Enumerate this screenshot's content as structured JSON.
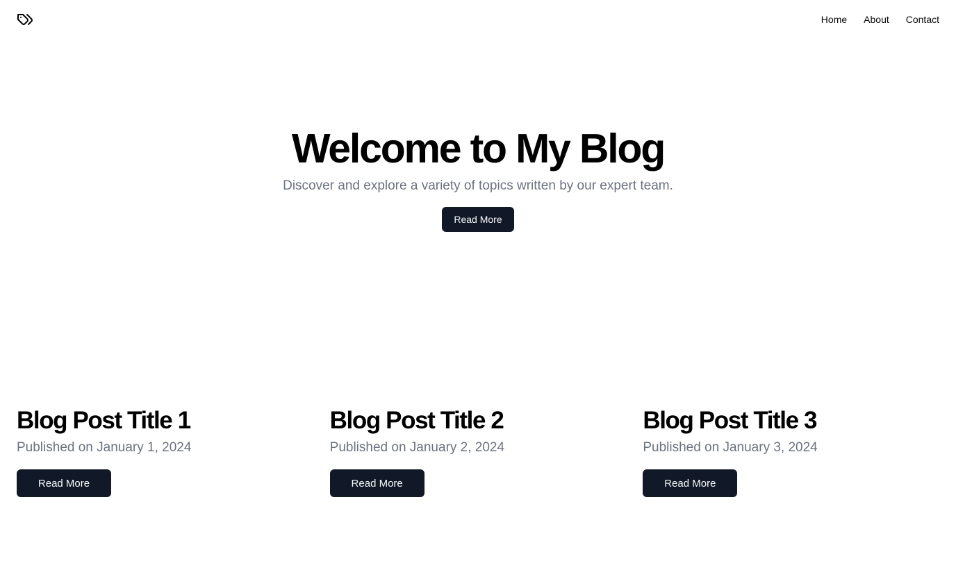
{
  "header": {
    "logo_icon": "tags-icon",
    "nav": [
      "Home",
      "About",
      "Contact"
    ]
  },
  "hero": {
    "title": "Welcome to My Blog",
    "subtitle": "Discover and explore a variety of topics written by our expert team.",
    "button_label": "Read More"
  },
  "posts": [
    {
      "title": "Blog Post Title 1",
      "meta": "Published on January 1, 2024",
      "button_label": "Read More"
    },
    {
      "title": "Blog Post Title 2",
      "meta": "Published on January 2, 2024",
      "button_label": "Read More"
    },
    {
      "title": "Blog Post Title 3",
      "meta": "Published on January 3, 2024",
      "button_label": "Read More"
    }
  ],
  "colors": {
    "button_bg": "#111827",
    "muted_text": "#6b7280",
    "text": "#09090b"
  }
}
